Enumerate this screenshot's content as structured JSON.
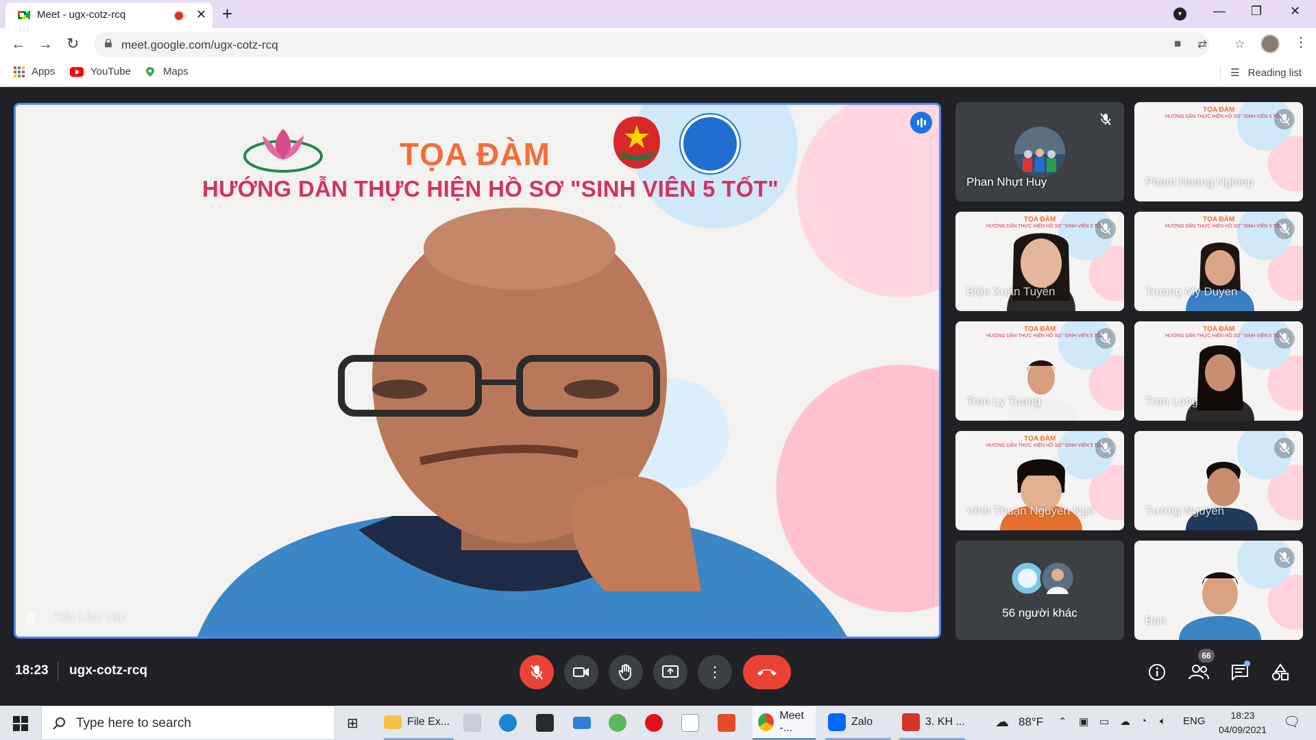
{
  "browser": {
    "tab_title": "Meet - ugx-cotz-rcq",
    "url": "meet.google.com/ugx-cotz-rcq",
    "bookmarks": [
      {
        "label": "Apps"
      },
      {
        "label": "YouTube"
      },
      {
        "label": "Maps"
      }
    ],
    "reading_list": "Reading list"
  },
  "main": {
    "banner_title": "TỌA ĐÀM",
    "banner_subtitle": "HƯỚNG DẪN THỰC HIỆN HỒ SƠ \"SINH VIÊN 5 TỐT\"",
    "speaker_name": "Tiến Lâm Văn"
  },
  "participants": [
    {
      "name": "Phan Nhựt Huy"
    },
    {
      "name": "Pham Hoang Nghiep"
    },
    {
      "name": "Biện Xuân Tuyền"
    },
    {
      "name": "Truong My Duyen"
    },
    {
      "name": "Tran Ly Tuong"
    },
    {
      "name": "Tran Long"
    },
    {
      "name": "Vĩnh Thuận Nguyễn Ngô"
    },
    {
      "name": "Tường Nguyễn"
    },
    {
      "name": "Ban"
    }
  ],
  "tile_banner": {
    "title": "TỌA ĐÀM",
    "subtitle": "HƯỚNG DẪN THỰC HIỆN HỒ SƠ \"SINH VIÊN 5 TỐT\""
  },
  "others": "56 người khác",
  "meeting": {
    "time": "18:23",
    "code": "ugx-cotz-rcq",
    "participant_count": "66"
  },
  "taskbar": {
    "search_placeholder": "Type here to search",
    "apps": [
      {
        "label": "File Ex..."
      },
      {
        "label": "Meet -..."
      },
      {
        "label": "Zalo"
      },
      {
        "label": "3. KH ..."
      }
    ],
    "weather": "88°F",
    "language": "ENG",
    "time": "18:23",
    "date": "04/09/2021"
  },
  "colors": {
    "accent": "#1a73e8",
    "danger": "#ea4335",
    "tab_strip": "#e8dcf5",
    "meet_bg": "#202124"
  }
}
